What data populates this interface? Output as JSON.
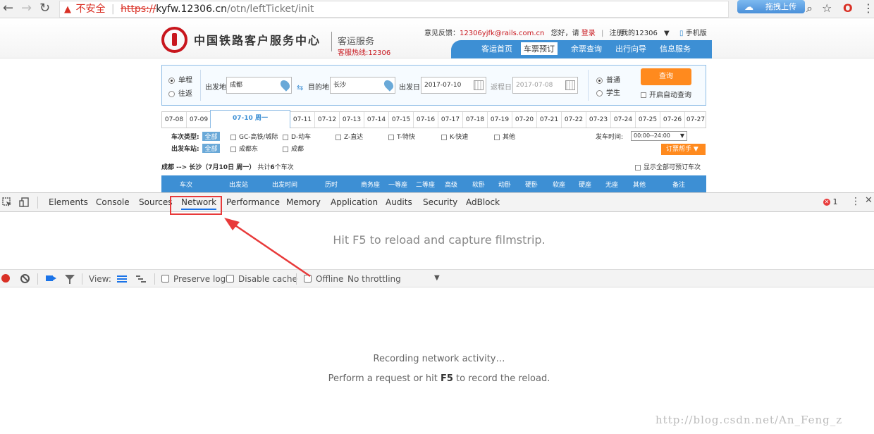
{
  "browser": {
    "insecure_label": "不安全",
    "url_scheme": "https://",
    "url_host": "kyfw.12306.cn",
    "url_path": "/otn/leftTicket/init",
    "extension_label": "拖拽上传"
  },
  "site": {
    "title": "中国铁路客户服务中心",
    "subtitle": "客运服务",
    "hotline": "客服热线:12306",
    "feedback_label": "意见反馈：",
    "feedback_email": "12306yjfk@rails.com.cn",
    "greeting": "您好，请",
    "login": "登录",
    "register": "注册",
    "my12306": "我的12306",
    "mobile": "手机版",
    "nav": [
      "客运首页",
      "车票预订",
      "余票查询",
      "出行向导",
      "信息服务"
    ],
    "query": {
      "one_way": "单程",
      "round_trip": "往返",
      "from_label": "出发地",
      "from_value": "成都",
      "to_label": "目的地",
      "to_value": "长沙",
      "date_label": "出发日",
      "date_value": "2017-07-10",
      "return_label": "返程日",
      "return_value": "2017-07-08",
      "normal": "普通",
      "student": "学生",
      "query_button": "查询",
      "auto_query": "开启自动查询"
    },
    "date_tabs": [
      "07-08",
      "07-09",
      "07-10 周一",
      "07-11",
      "07-12",
      "07-13",
      "07-14",
      "07-15",
      "07-16",
      "07-17",
      "07-18",
      "07-19",
      "07-20",
      "07-21",
      "07-22",
      "07-23",
      "07-24",
      "07-25",
      "07-26",
      "07-27"
    ],
    "filters": {
      "train_type_label": "车次类型:",
      "all": "全部",
      "types": [
        "GC-高铁/城际",
        "D-动车",
        "Z-直达",
        "T-特快",
        "K-快速",
        "其他"
      ],
      "station_label": "出发车站:",
      "stations": [
        "成都东",
        "成都"
      ],
      "time_label": "发车时间:",
      "time_value": "00:00--24:00",
      "helper_button": "订票帮手"
    },
    "summary_route": "成都 --> 长沙（7月10日 周一）",
    "summary_count_prefix": "共计",
    "summary_count": "6",
    "summary_count_suffix": "个车次",
    "show_all": "显示全部可预订车次",
    "table_headers": [
      "车次",
      "出发站",
      "出发时间",
      "历时",
      "商务座",
      "一等座",
      "二等座",
      "高级",
      "软卧",
      "动卧",
      "硬卧",
      "软座",
      "硬座",
      "无座",
      "其他",
      "备注"
    ]
  },
  "devtools": {
    "tabs": [
      "Elements",
      "Console",
      "Sources",
      "Network",
      "Performance",
      "Memory",
      "Application",
      "Audits",
      "Security",
      "AdBlock"
    ],
    "active_tab": "Network",
    "error_count": "1",
    "filmstrip_message": "Hit F5 to reload and capture filmstrip.",
    "view_label": "View:",
    "preserve_log": "Preserve log",
    "disable_cache": "Disable cache",
    "offline": "Offline",
    "throttling": "No throttling",
    "recording": "Recording network activity…",
    "perform_prefix": "Perform a request or hit ",
    "perform_key": "F5",
    "perform_suffix": " to record the reload."
  },
  "watermark": "http://blog.csdn.net/An_Feng_z",
  "colors": {
    "annotation_red": "#e83a3a",
    "site_blue": "#3d8fd4",
    "site_orange": "#ff8a1e",
    "record_red": "#d93025"
  }
}
